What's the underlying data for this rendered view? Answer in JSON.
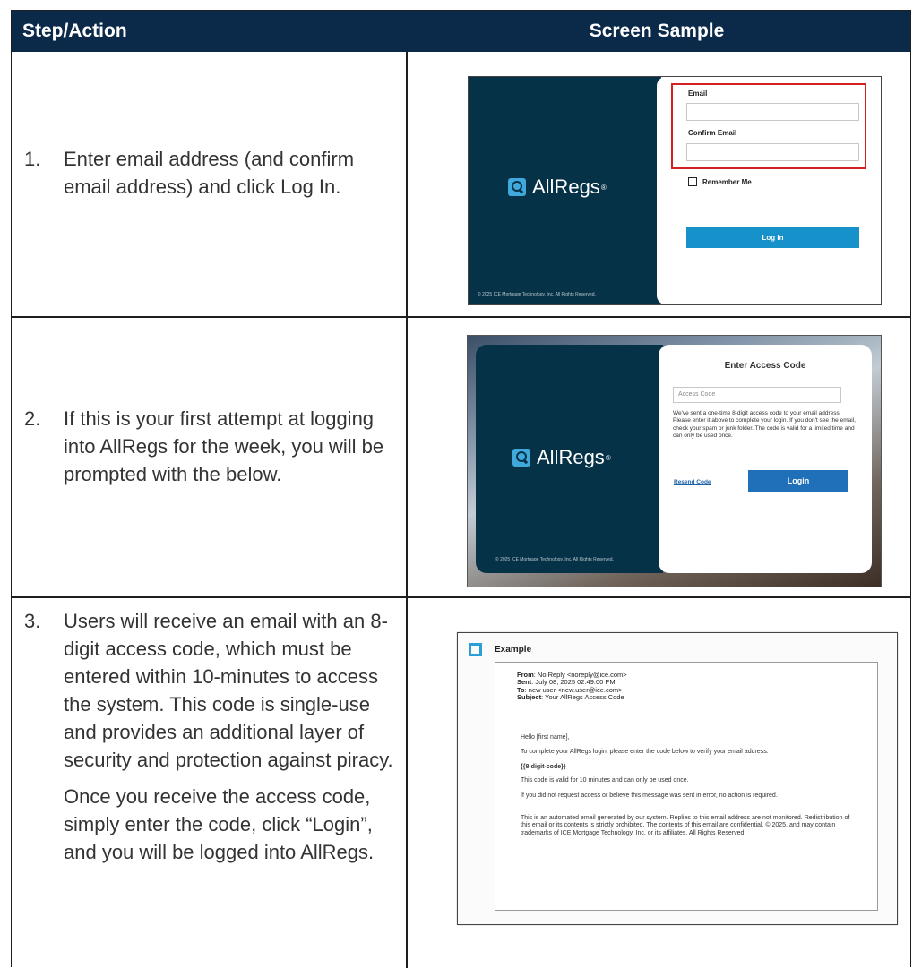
{
  "header": {
    "col1": "Step/Action",
    "col2": "Screen Sample"
  },
  "rows": [
    {
      "num": "1.",
      "text": "Enter email address (and confirm email address) and click Log In."
    },
    {
      "num": "2.",
      "text": "If this is your first attempt at logging into AllRegs for the week, you will be prompted with the below."
    },
    {
      "num": "3.",
      "text": "Users will receive an email with an 8-digit access code, which must be entered within 10-minutes to access the system. This code is single-use and provides an additional layer of security and protection against piracy.",
      "text2": "Once you receive the access code, simply enter the code, click “Login”, and you will be logged into AllRegs."
    }
  ],
  "sample1": {
    "brand": "AllRegs",
    "trademark": "®",
    "copyright": "© 2025 ICE Mortgage Technology, Inc. All Rights Reserved.",
    "email_label": "Email",
    "confirm_label": "Confirm Email",
    "remember_label": "Remember Me",
    "login_button": "Log In"
  },
  "sample2": {
    "brand": "AllRegs",
    "trademark": "®",
    "copyright": "© 2025 ICE Mortgage Technology, Inc. All Rights Reserved.",
    "title": "Enter Access Code",
    "code_placeholder": "Access Code",
    "info": "We've sent a one-time 8-digit access code to your email address. Please enter it above to complete your login. If you don't see the email, check your spam or junk folder. The code is valid for a limited time and can only be used once.",
    "resend_link": "Resend Code",
    "login_button": "Login"
  },
  "sample3": {
    "title": "Example",
    "from_label": "From",
    "from": ": No Reply <noreply@ice.com>",
    "sent_label": "Sent",
    "sent": ": July 08, 2025 02:49:00 PM",
    "to_label": "To",
    "to": ": new user <new.user@ice.com>",
    "subject_label": "Subject",
    "subject": ": Your AllRegs Access Code",
    "greeting": "Hello [first name],",
    "line1": "To complete your AllRegs login, please enter the code below to verify your email address:",
    "code": "{{8-digit-code}}",
    "line2": "This code is valid for 10 minutes and can only be used once.",
    "line3": "If you did not request access or believe this message was sent in error, no action is required.",
    "line4": "This is an automated email generated by our system. Replies to this email address are not monitored. Redistribution of this email or its contents is strictly prohibited. The contents of this email are confidential, © 2025, and may contain trademarks of ICE Mortgage Technology, Inc. or its affiliates. All Rights Reserved."
  },
  "colors": {
    "header_bg": "#0b2a4a",
    "brand_navy": "#063247",
    "login_blue": "#1791c9",
    "highlight_red": "#d42020"
  }
}
